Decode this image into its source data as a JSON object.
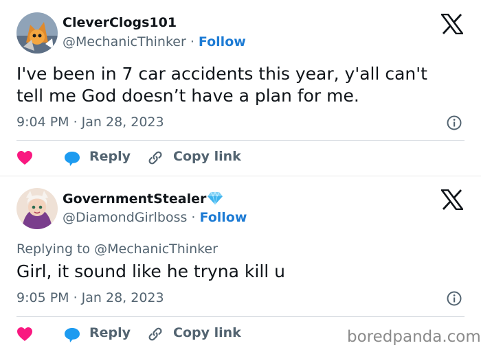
{
  "tweets": [
    {
      "display_name": "CleverClogs101",
      "handle": "@MechanicThinker",
      "separator": " · ",
      "follow_label": "Follow",
      "replying_to": "",
      "text": "I've been in 7 car accidents this year, y'all can't tell me God doesn’t have a plan for me.",
      "timestamp": "9:04 PM · Jan 28, 2023",
      "reply_label": "Reply",
      "copy_link_label": "Copy link"
    },
    {
      "display_name": "GovernmentStealer",
      "handle": "@DiamondGirlboss",
      "separator": " · ",
      "follow_label": "Follow",
      "replying_to": "Replying to @MechanicThinker",
      "text": "Girl, it sound like he tryna kill u",
      "timestamp": "9:05 PM · Jan 28, 2023",
      "reply_label": "Reply",
      "copy_link_label": "Copy link"
    }
  ],
  "watermark": "boredpanda.com",
  "colors": {
    "accent": "#1d7bd4",
    "heart": "#f91880",
    "secondary_text": "#536471",
    "primary_text": "#0f1419",
    "reply_icon": "#1d9bf0"
  }
}
